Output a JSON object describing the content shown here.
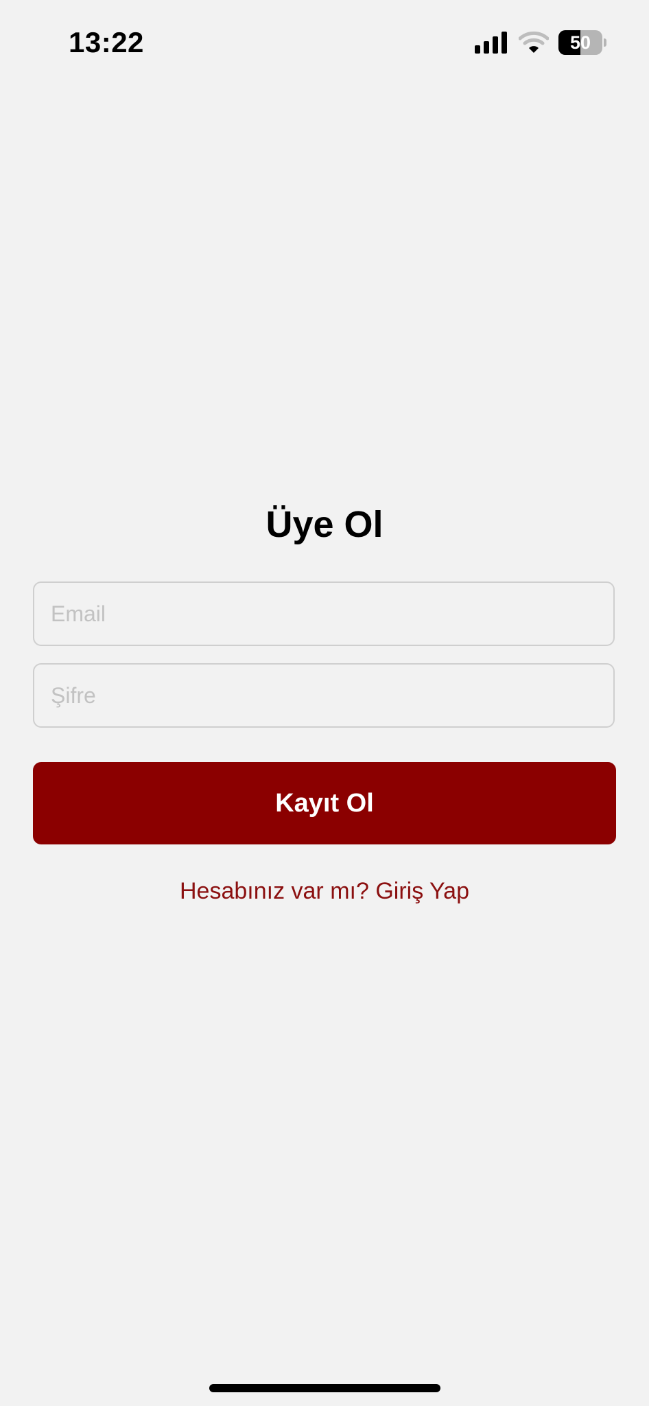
{
  "status_bar": {
    "time": "13:22",
    "battery_level": "50",
    "battery_fraction": 0.5,
    "icons": [
      "signal-icon",
      "wifi-icon",
      "battery-icon"
    ]
  },
  "form": {
    "title": "Üye Ol",
    "email_placeholder": "Email",
    "password_placeholder": "Şifre",
    "submit_label": "Kayıt Ol",
    "login_link": "Hesabınız var mı? Giriş Yap"
  },
  "colors": {
    "background": "#f2f2f2",
    "accent": "#8b0000",
    "link": "#8b1010"
  }
}
